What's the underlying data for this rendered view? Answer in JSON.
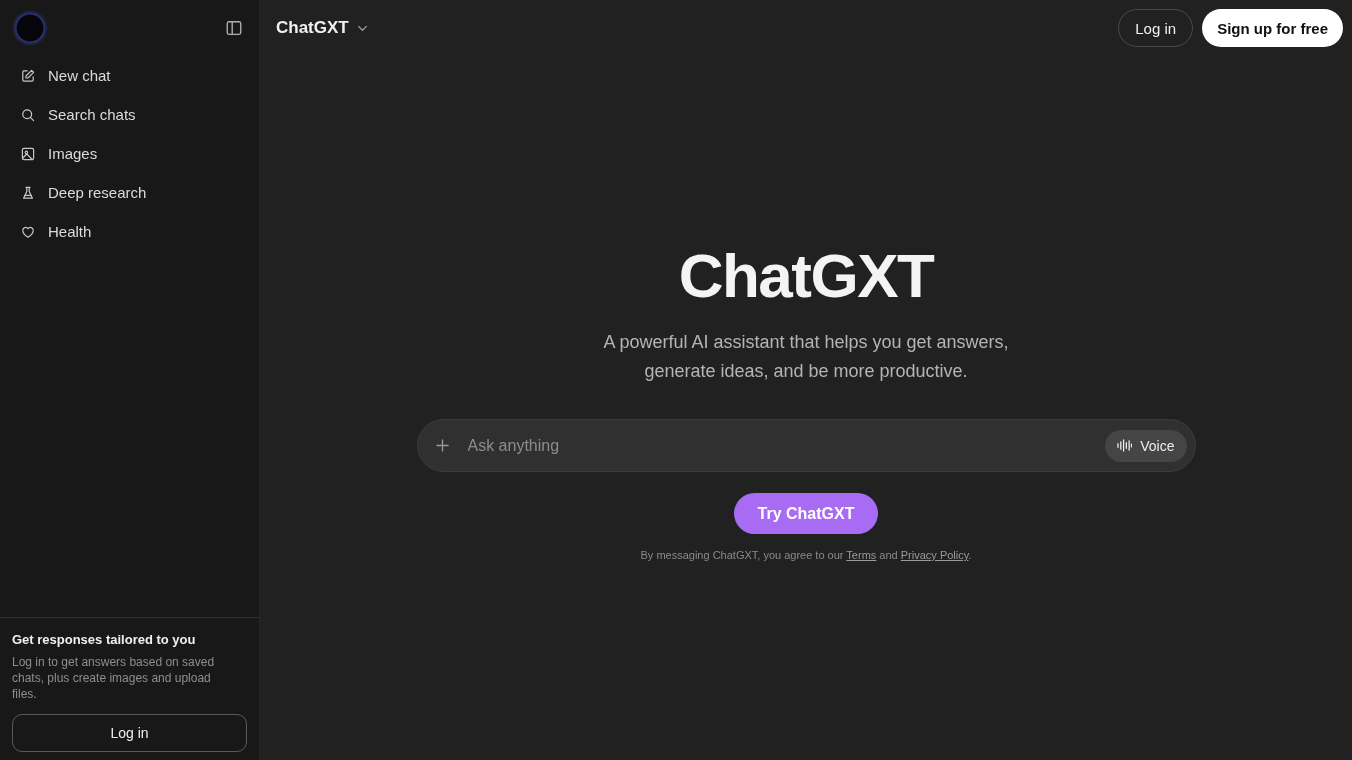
{
  "sidebar": {
    "items": [
      {
        "kind": "compose",
        "label": "New chat"
      },
      {
        "kind": "search",
        "label": "Search chats"
      },
      {
        "kind": "images",
        "label": "Images"
      },
      {
        "kind": "research",
        "label": "Deep research"
      },
      {
        "kind": "health",
        "label": "Health"
      }
    ],
    "promo": {
      "title": "Get responses tailored to you",
      "text": "Log in to get answers based on saved chats, plus create images and upload files.",
      "button": "Log in"
    }
  },
  "header": {
    "model": "ChatGXT",
    "login": "Log in",
    "signup": "Sign up for free"
  },
  "hero": {
    "title": "ChatGXT",
    "subtitle": "A powerful AI assistant that helps you get answers, generate ideas, and be more productive."
  },
  "composer": {
    "placeholder": "Ask anything",
    "voice": "Voice"
  },
  "cta": "Try ChatGXT",
  "legal": [
    {
      "kind": "text",
      "text": "By messaging ChatGXT, you agree to our "
    },
    {
      "kind": "link",
      "text": "Terms"
    },
    {
      "kind": "text",
      "text": " and "
    },
    {
      "kind": "link",
      "text": "Privacy Policy"
    },
    {
      "kind": "text",
      "text": "."
    }
  ]
}
